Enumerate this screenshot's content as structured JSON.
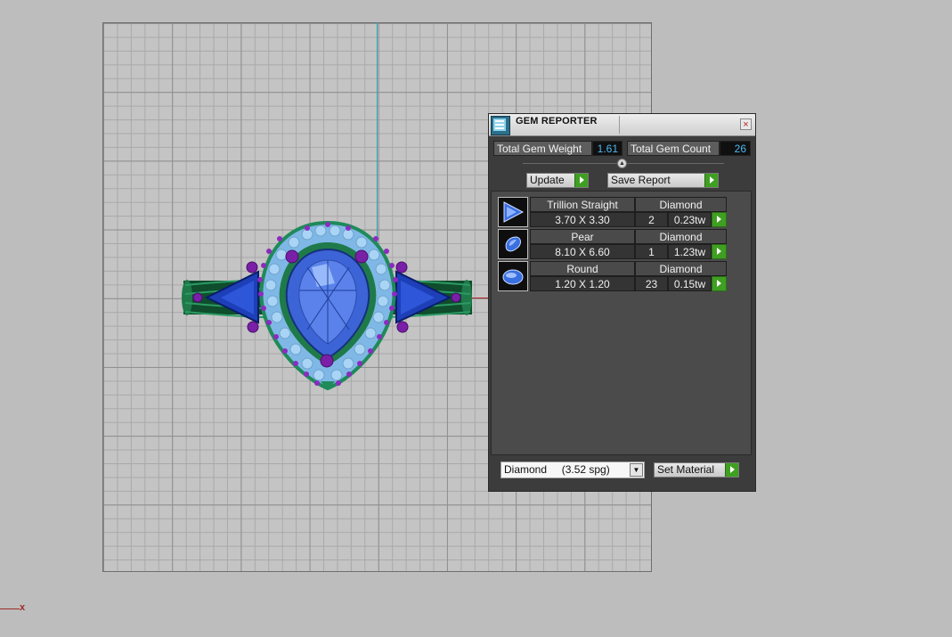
{
  "panel": {
    "title": "GEM REPORTER",
    "close_glyph": "×",
    "total_gem_weight_label": "Total Gem Weight",
    "total_gem_weight_value": "1.61",
    "total_gem_count_label": "Total Gem Count",
    "total_gem_count_value": "26",
    "update_label": "Update",
    "save_report_label": "Save Report",
    "gems": [
      {
        "shape": "Trillion Straight",
        "material": "Diamond",
        "size": "3.70 X 3.30",
        "qty": "2",
        "weight": "0.23tw",
        "icon": "trillion-gem-icon"
      },
      {
        "shape": "Pear",
        "material": "Diamond",
        "size": "8.10 X 6.60",
        "qty": "1",
        "weight": "1.23tw",
        "icon": "pear-gem-icon"
      },
      {
        "shape": "Round",
        "material": "Diamond",
        "size": "1.20 X 1.20",
        "qty": "23",
        "weight": "0.15tw",
        "icon": "round-gem-icon"
      }
    ],
    "material_select": "Diamond     (3.52 spg)",
    "set_material_label": "Set Material"
  },
  "viewport": {
    "origin_marker": "x"
  },
  "colors": {
    "grid": "#c4c4c4",
    "axis_y": "#1aa7b3",
    "axis_x": "#b22222",
    "panel": "#3c3c3c",
    "value_text": "#4fb7f0",
    "go_arrow": "#3f9f21"
  }
}
